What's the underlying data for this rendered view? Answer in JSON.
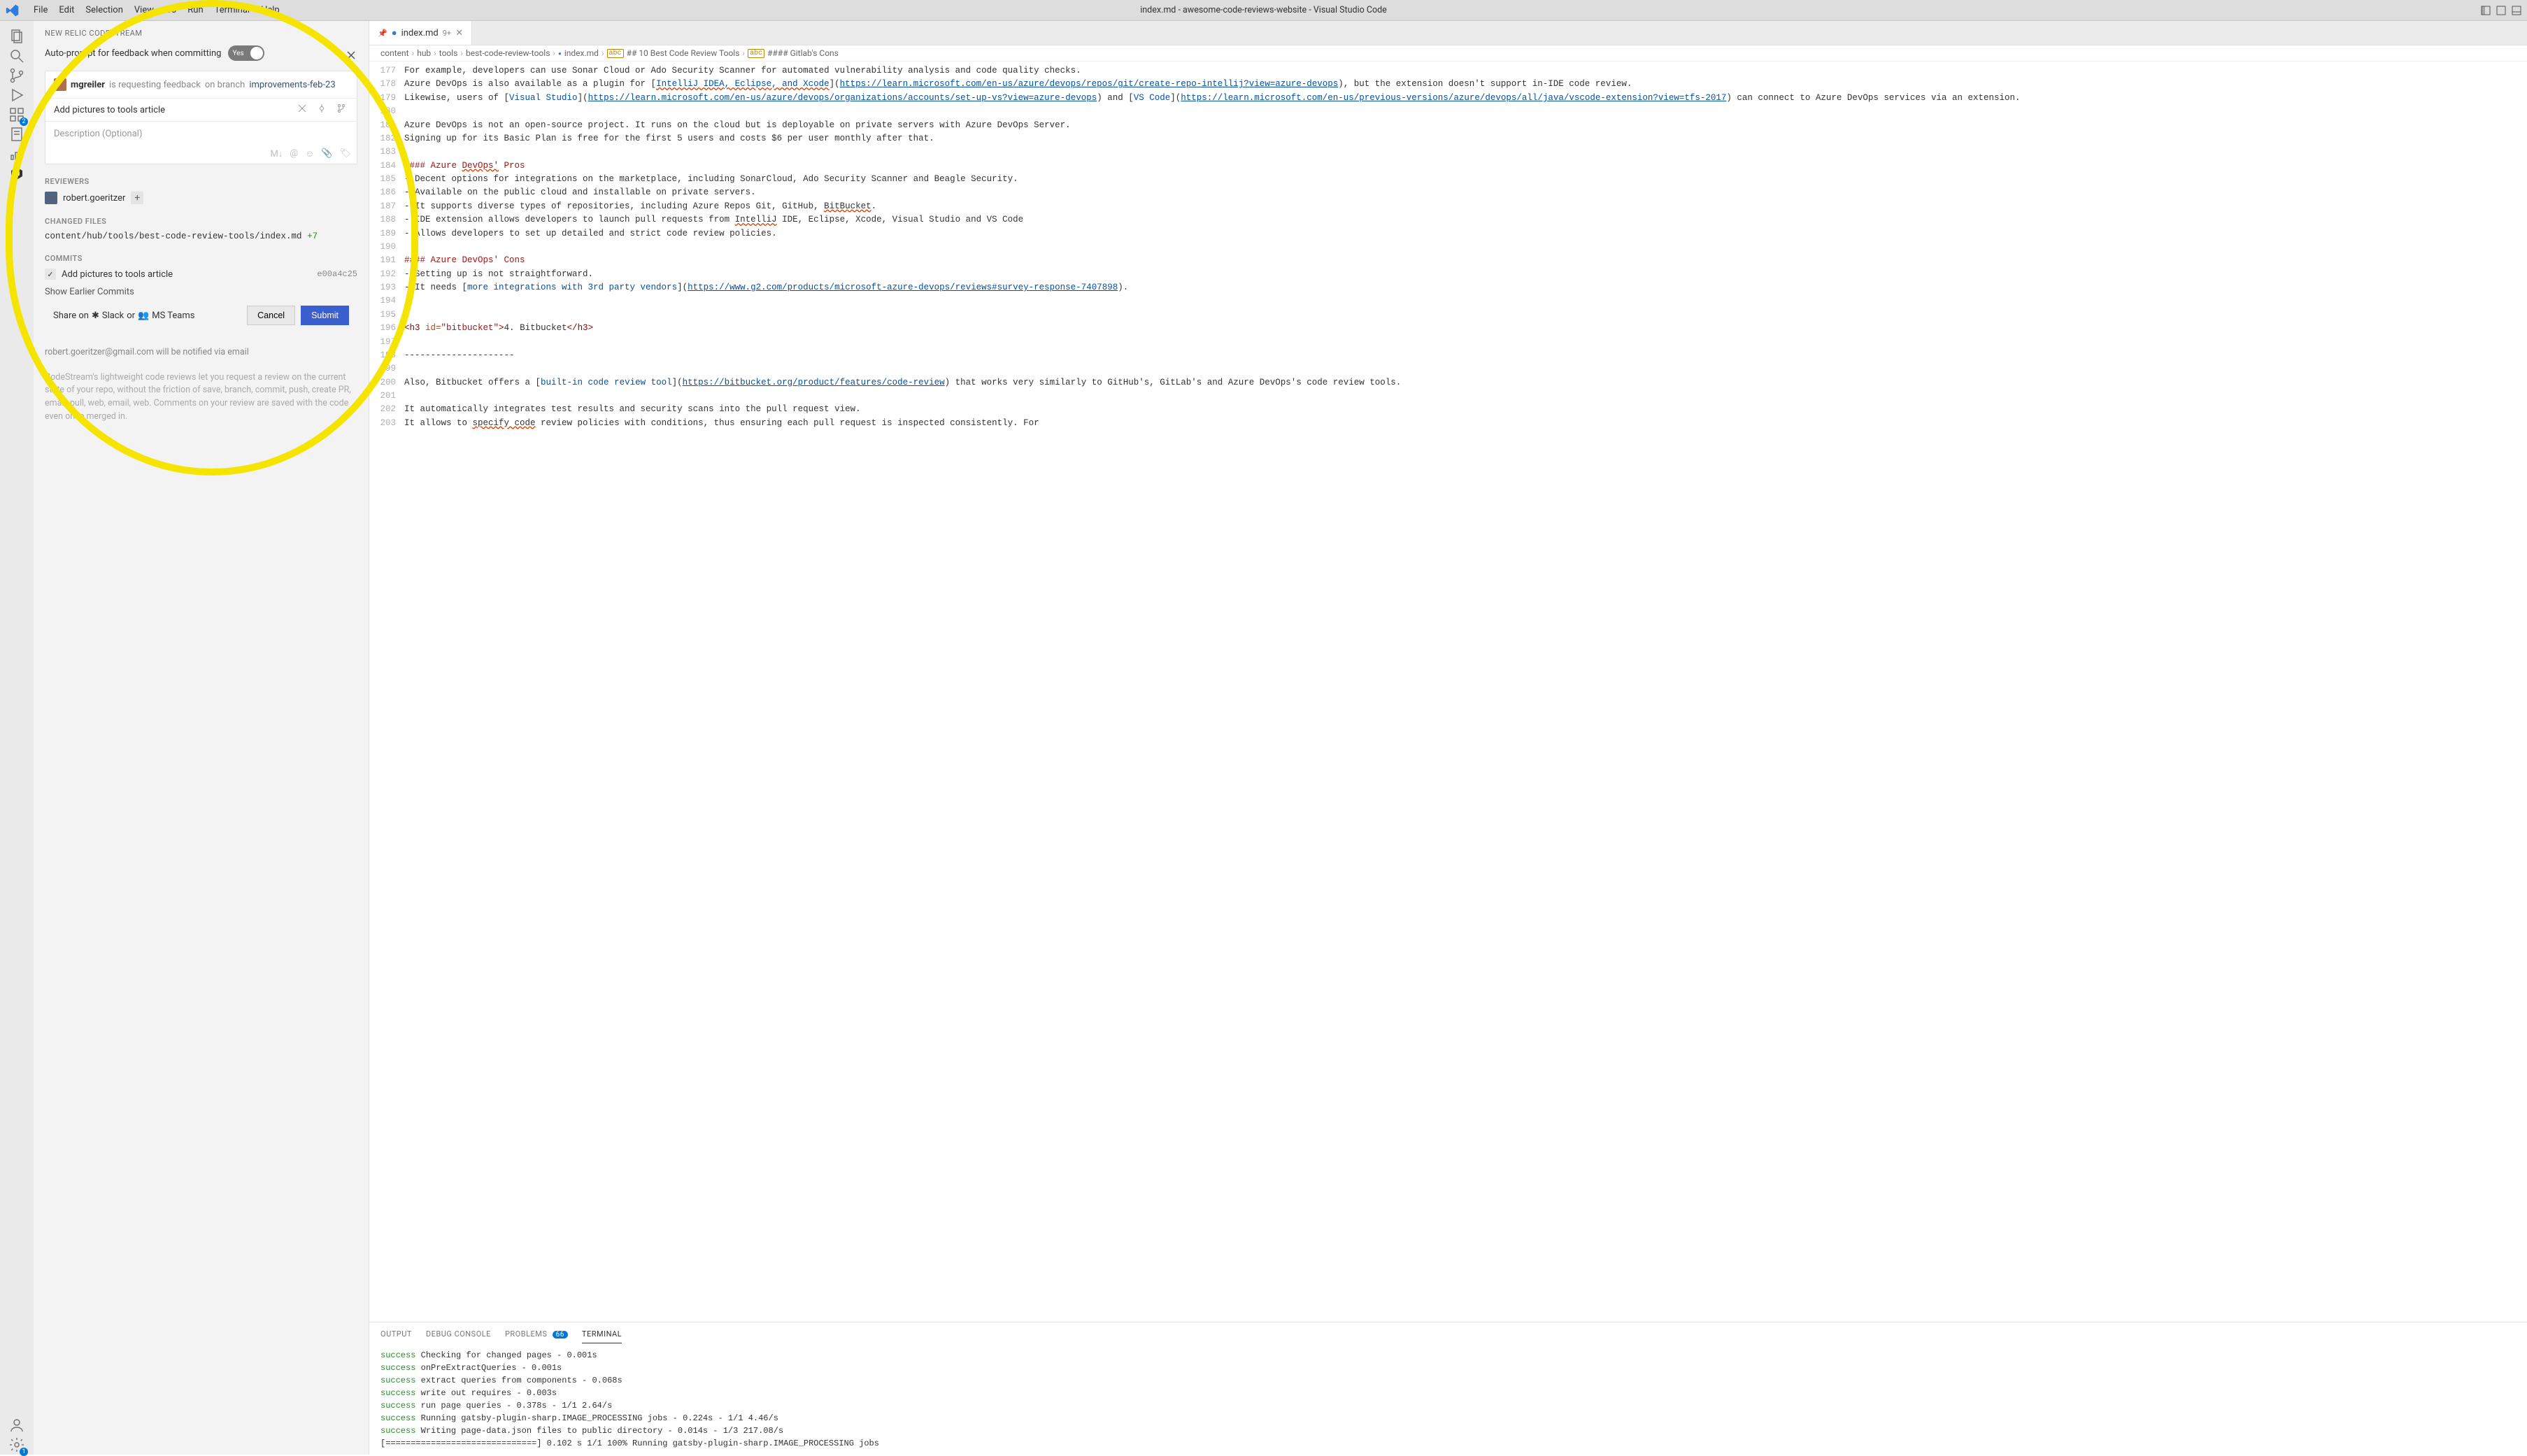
{
  "window": {
    "title": "index.md - awesome-code-reviews-website - Visual Studio Code"
  },
  "menubar": [
    "File",
    "Edit",
    "Selection",
    "View",
    "Go",
    "Run",
    "Terminal",
    "Help"
  ],
  "activity_bar": {
    "top": [
      {
        "name": "explorer-icon"
      },
      {
        "name": "search-icon"
      },
      {
        "name": "source-control-icon"
      },
      {
        "name": "run-debug-icon"
      },
      {
        "name": "extensions-icon",
        "badge": "2"
      },
      {
        "name": "notes-icon"
      },
      {
        "name": "graph-icon"
      },
      {
        "name": "codestream-icon",
        "active": true
      }
    ],
    "bottom": [
      {
        "name": "accounts-icon"
      },
      {
        "name": "settings-icon",
        "badge": "1"
      }
    ]
  },
  "sidebar": {
    "title": "NEW RELIC CODESTREAM",
    "auto_prompt_label": "Auto-prompt for feedback when committing",
    "toggle_label": "Yes",
    "request": {
      "author": "mgreiler",
      "action_text": "is requesting feedback",
      "on_branch_text": "on branch",
      "branch": "improvements-feb-23"
    },
    "title_input": "Add pictures to tools article",
    "description_placeholder": "Description (Optional)",
    "reviewers_title": "REVIEWERS",
    "reviewers": [
      {
        "name": "robert.goeritzer"
      }
    ],
    "changed_files_title": "CHANGED FILES",
    "changed_file": {
      "path": "content/hub/tools/best-code-review-tools/index.md",
      "delta": "+7"
    },
    "commits_title": "COMMITS",
    "commit": {
      "message": "Add pictures to tools article",
      "hash": "e00a4c25",
      "checked": true
    },
    "show_earlier": "Show Earlier Commits",
    "share": {
      "prefix": "Share on",
      "slack": "Slack",
      "or": "or",
      "teams": "MS Teams"
    },
    "buttons": {
      "cancel": "Cancel",
      "submit": "Submit"
    },
    "notify": "robert.goeritzer@gmail.com will be notified via email",
    "help": "CodeStream's lightweight code reviews let you request a review on the current state of your repo, without the friction of save, branch, commit, push, create PR, email, pull, web, email, web. Comments on your review are saved with the code even once merged in."
  },
  "tab": {
    "filename": "index.md",
    "modified_marker": "9+"
  },
  "breadcrumbs": [
    "content",
    "hub",
    "tools",
    "best-code-review-tools",
    "index.md",
    "## 10 Best Code Review Tools",
    "#### Gitlab's Cons"
  ],
  "editor_lines": [
    {
      "n": 177,
      "segments": [
        {
          "t": "For example, developers can use Sonar Cloud or Ado Security Scanner for automated vulnerability analysis and code quality checks."
        }
      ]
    },
    {
      "n": 178,
      "segments": [
        {
          "t": "Azure DevOps is also available as a plugin for ["
        },
        {
          "t": "IntelliJ IDEA, Eclipse, and Xcode",
          "cls": "sq err"
        },
        {
          "t": "]("
        },
        {
          "t": "https://learn.microsoft.com/en-us/azure/devops/repos/git/create-repo-intellij?view=azure-devops",
          "cls": "lnk"
        },
        {
          "t": "), but the extension doesn't support in-IDE code review."
        }
      ]
    },
    {
      "n": 179,
      "segments": [
        {
          "t": "Likewise, users of ["
        },
        {
          "t": "Visual Studio",
          "cls": "sq"
        },
        {
          "t": "]("
        },
        {
          "t": "https://learn.microsoft.com/en-us/azure/devops/organizations/accounts/set-up-vs?view=azure-devops",
          "cls": "lnk"
        },
        {
          "t": ") and ["
        },
        {
          "t": "VS Code",
          "cls": "sq"
        },
        {
          "t": "]("
        },
        {
          "t": "https://learn.microsoft.com/en-us/previous-versions/azure/devops/all/java/vscode-extension?view=tfs-2017",
          "cls": "lnk"
        },
        {
          "t": ") can connect to Azure DevOps services via an extension."
        }
      ]
    },
    {
      "n": 180,
      "segments": []
    },
    {
      "n": 181,
      "segments": [
        {
          "t": "Azure DevOps is not an open-source project. It runs on the cloud but is deployable on private servers with Azure DevOps Server."
        }
      ]
    },
    {
      "n": 182,
      "segments": [
        {
          "t": "Signing up for its Basic Plan is free for the first 5 users and costs $6 per user monthly after that."
        }
      ]
    },
    {
      "n": 183,
      "segments": []
    },
    {
      "n": 184,
      "segments": [
        {
          "t": "#### Azure ",
          "cls": "hd"
        },
        {
          "t": "DevOps'",
          "cls": "hd err"
        },
        {
          "t": " Pros",
          "cls": "hd"
        }
      ]
    },
    {
      "n": 185,
      "segments": [
        {
          "t": "- Decent options for integrations on the marketplace, including SonarCloud, Ado Security Scanner and Beagle Security."
        }
      ]
    },
    {
      "n": 186,
      "segments": [
        {
          "t": "- Available on the public cloud and installable on private servers."
        }
      ]
    },
    {
      "n": 187,
      "segments": [
        {
          "t": "- It supports diverse types of repositories, including Azure Repos Git, GitHub, "
        },
        {
          "t": "BitBucket",
          "cls": "err"
        },
        {
          "t": "."
        }
      ]
    },
    {
      "n": 188,
      "segments": [
        {
          "t": "- IDE extension allows developers to launch pull requests from "
        },
        {
          "t": "IntelliJ",
          "cls": "err"
        },
        {
          "t": " IDE, Eclipse, Xcode, Visual Studio and VS Code"
        }
      ]
    },
    {
      "n": 189,
      "segments": [
        {
          "t": "- Allows developers to set up detailed and strict code review policies."
        }
      ]
    },
    {
      "n": 190,
      "segments": []
    },
    {
      "n": 191,
      "segments": [
        {
          "t": "#### Azure DevOps' Cons",
          "cls": "hd"
        }
      ]
    },
    {
      "n": 192,
      "segments": [
        {
          "t": "- Setting up is not straightforward."
        }
      ]
    },
    {
      "n": 193,
      "segments": [
        {
          "t": "- It needs ["
        },
        {
          "t": "more integrations with 3rd party vendors",
          "cls": "sq"
        },
        {
          "t": "]("
        },
        {
          "t": "https://www.g2.com/products/microsoft-azure-devops/reviews#survey-response-7407898",
          "cls": "lnk"
        },
        {
          "t": ")."
        }
      ]
    },
    {
      "n": 194,
      "segments": []
    },
    {
      "n": 195,
      "segments": []
    },
    {
      "n": 196,
      "segments": [
        {
          "t": "<h3 ",
          "cls": "tag"
        },
        {
          "t": "id=",
          "cls": "attr"
        },
        {
          "t": "\"bitbucket\"",
          "cls": "str"
        },
        {
          "t": ">",
          "cls": "tag"
        },
        {
          "t": "4. Bitbucket"
        },
        {
          "t": "</h3>",
          "cls": "tag"
        }
      ]
    },
    {
      "n": 197,
      "segments": []
    },
    {
      "n": 198,
      "segments": [
        {
          "t": "---------------------"
        }
      ]
    },
    {
      "n": 199,
      "segments": []
    },
    {
      "n": 200,
      "segments": [
        {
          "t": "Also, Bitbucket offers a ["
        },
        {
          "t": "built-in code review tool",
          "cls": "sq"
        },
        {
          "t": "]("
        },
        {
          "t": "https://bitbucket.org/product/features/code-review",
          "cls": "lnk"
        },
        {
          "t": ") that works very similarly to GitHub's, GitLab's and Azure DevOps's code review tools."
        }
      ]
    },
    {
      "n": 201,
      "segments": []
    },
    {
      "n": 202,
      "segments": [
        {
          "t": "It automatically integrates test results and security scans into the pull request view."
        }
      ]
    },
    {
      "n": 203,
      "segments": [
        {
          "t": "It allows to "
        },
        {
          "t": "specify code",
          "cls": "err"
        },
        {
          "t": " review policies with conditions, thus ensuring each pull request is inspected consistently. For"
        }
      ]
    }
  ],
  "panel": {
    "tabs": {
      "output": "OUTPUT",
      "debug": "DEBUG CONSOLE",
      "problems": "PROBLEMS",
      "problems_badge": "66",
      "terminal": "TERMINAL"
    },
    "lines": [
      {
        "pre": "success",
        "txt": " Checking for changed pages - 0.001s"
      },
      {
        "pre": "success",
        "txt": " onPreExtractQueries - 0.001s"
      },
      {
        "pre": "success",
        "txt": " extract queries from components - 0.068s"
      },
      {
        "pre": "success",
        "txt": " write out requires - 0.003s"
      },
      {
        "pre": "success",
        "txt": " run page queries - 0.378s - 1/1 2.64/s"
      },
      {
        "pre": "success",
        "txt": " Running gatsby-plugin-sharp.IMAGE_PROCESSING jobs - 0.224s - 1/1 4.46/s"
      },
      {
        "pre": "success",
        "txt": " Writing page-data.json files to public directory - 0.014s - 1/3 217.08/s"
      },
      {
        "pre": "",
        "txt": "[==============================]   0.102 s 1/1 100% Running gatsby-plugin-sharp.IMAGE_PROCESSING jobs"
      }
    ]
  }
}
